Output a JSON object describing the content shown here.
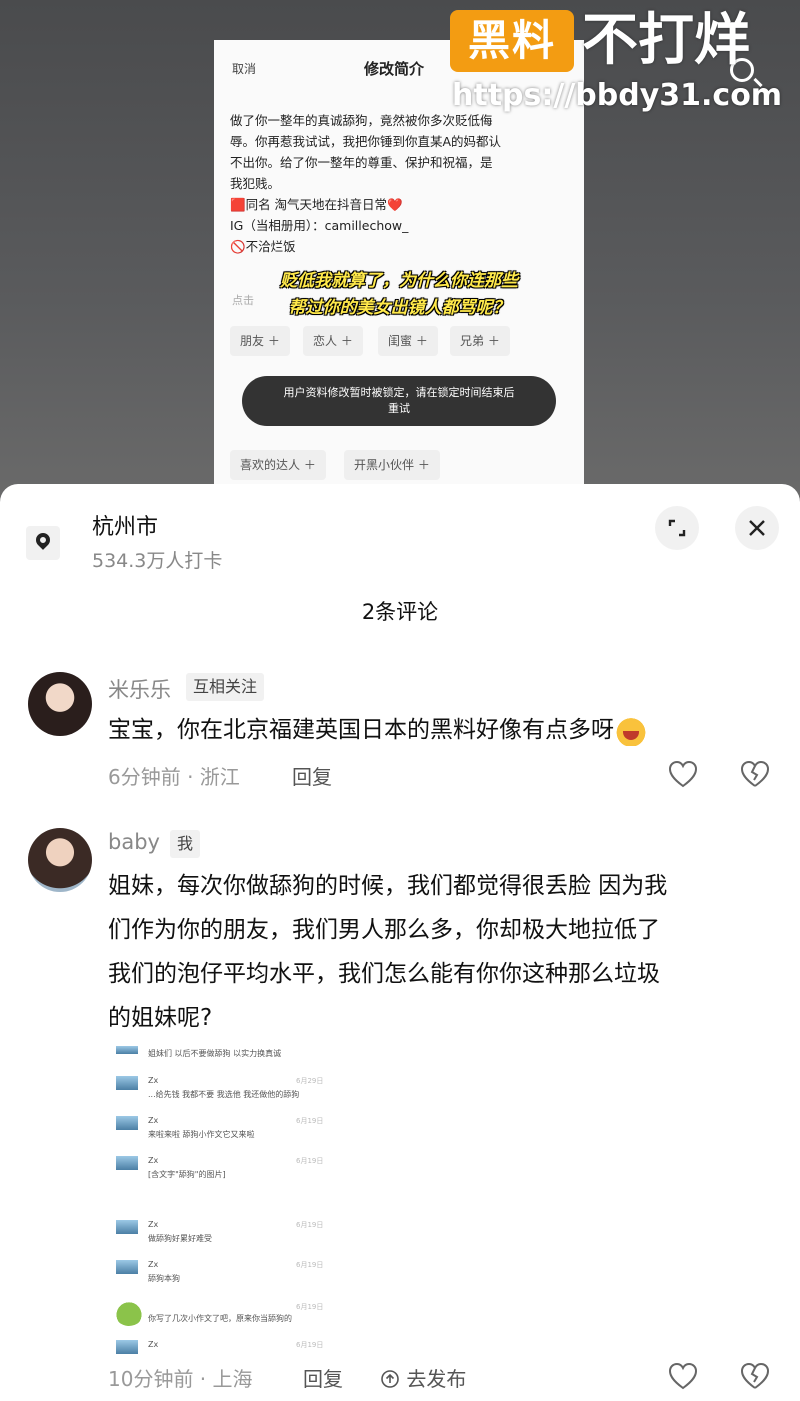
{
  "phone": {
    "cancel": "取消",
    "title": "修改简介",
    "bio_lines": [
      "做了你一整年的真诚舔狗，竟然被你多次贬低侮",
      "辱。你再惹我试试，我把你锤到你直某A的妈都认",
      "不出你。给了你一整年的尊重、保护和祝福，是",
      "我犯贱。",
      "🟥同名  淘气天地在抖音日常❤️",
      "IG（当相册用）：camillechow_",
      "🚫不洽烂饭"
    ],
    "hint": "点击",
    "caption_lines": [
      "贬低我就算了，为什么你连那些",
      "帮过你的美女出镜人都骂呢？"
    ],
    "chips_row1": [
      "朋友 ＋",
      "恋人 ＋",
      "闺蜜 ＋",
      "兄弟 ＋"
    ],
    "chips_row2": [
      "喜欢的达人 ＋",
      "开黑小伙伴 ＋"
    ],
    "toast_lines": [
      "用户资料修改暂时被锁定，请在锁定时间结束后",
      "重试"
    ]
  },
  "watermark": {
    "badge": "黑料",
    "text": "不打烊",
    "url": "https://bbdy31.com"
  },
  "location": {
    "name": "杭州市",
    "count": "534.3万人打卡"
  },
  "icons": {
    "location": "location-pin-icon",
    "expand": "expand-icon",
    "close": "close-icon",
    "like": "heart-icon",
    "dislike": "broken-heart-icon",
    "share": "share-icon"
  },
  "comments_header": "2条评论",
  "comments": [
    {
      "user": "米乐乐",
      "tag": "互相关注",
      "lines": [
        "宝宝，你在北京福建英国日本的黑料好像有点多呀"
      ],
      "time": "6分钟前 · 浙江",
      "reply": "回复"
    },
    {
      "user": "baby",
      "tag": "我",
      "lines": [
        "姐妹，每次你做舔狗的时候，我们都觉得很丢脸  因为我",
        "们作为你的朋友，我们男人那么多，你却极大地拉低了",
        "我们的泡仔平均水平，我们怎么能有你你这种那么垃圾",
        "的姐妹呢?"
      ],
      "time": "10分钟前 · 上海",
      "reply": "回复",
      "share": "去发布"
    }
  ],
  "chat": {
    "header": "姐妹们 以后不要做舔狗 以实力换真诚",
    "messages": [
      {
        "name": "Zx",
        "text": "...给先钱 我都不要 我选他 我还做他的舔狗",
        "date": "6月29日"
      },
      {
        "name": "Zx",
        "text": "来啦来啦 舔狗小作文它又来啦",
        "date": "6月19日"
      },
      {
        "name": "Zx",
        "text": "[含文字\"舔狗\"的图片]",
        "date": "6月19日"
      },
      {
        "name": "Zx",
        "text": "做舔狗好累好难受",
        "date": "6月19日"
      },
      {
        "name": "Zx",
        "text": "舔狗本狗",
        "date": "6月19日"
      },
      {
        "name": "",
        "text": "你写了几次小作文了吧，原来你当舔狗的",
        "date": "6月19日"
      },
      {
        "name": "Zx",
        "text": "",
        "date": "6月19日"
      }
    ]
  }
}
